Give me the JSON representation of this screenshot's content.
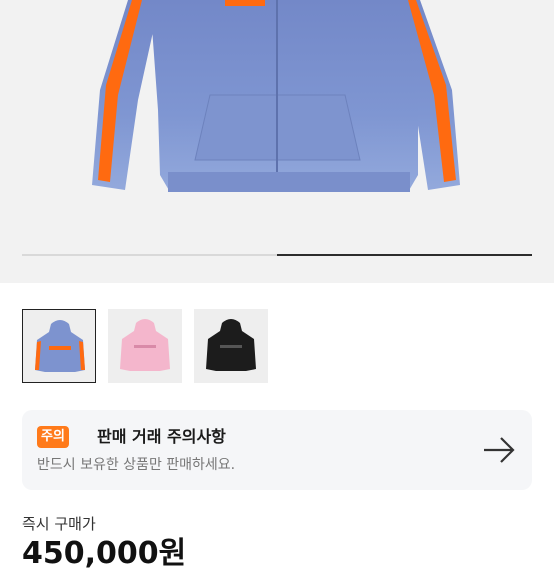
{
  "product": {
    "image_icon": "hoodie-image",
    "body_color": "#7d93cf",
    "stripe_color": "#ff6a10",
    "carousel_progress": 0.5
  },
  "thumbnails": [
    {
      "color": "#7d93cf",
      "accent": "#ff6a10",
      "selected": true
    },
    {
      "color": "#f4b6cc",
      "accent": "#f4b6cc",
      "selected": false
    },
    {
      "color": "#1c1c1c",
      "accent": "#1c1c1c",
      "selected": false
    }
  ],
  "notice": {
    "badge": "주의",
    "title": "판매 거래 주의사항",
    "subtitle": "반드시 보유한 상품만 판매하세요.",
    "icon": "arrow-right-icon",
    "badge_color": "#ff7a1a"
  },
  "price": {
    "label": "즉시 구매가",
    "value": "450,000원"
  }
}
